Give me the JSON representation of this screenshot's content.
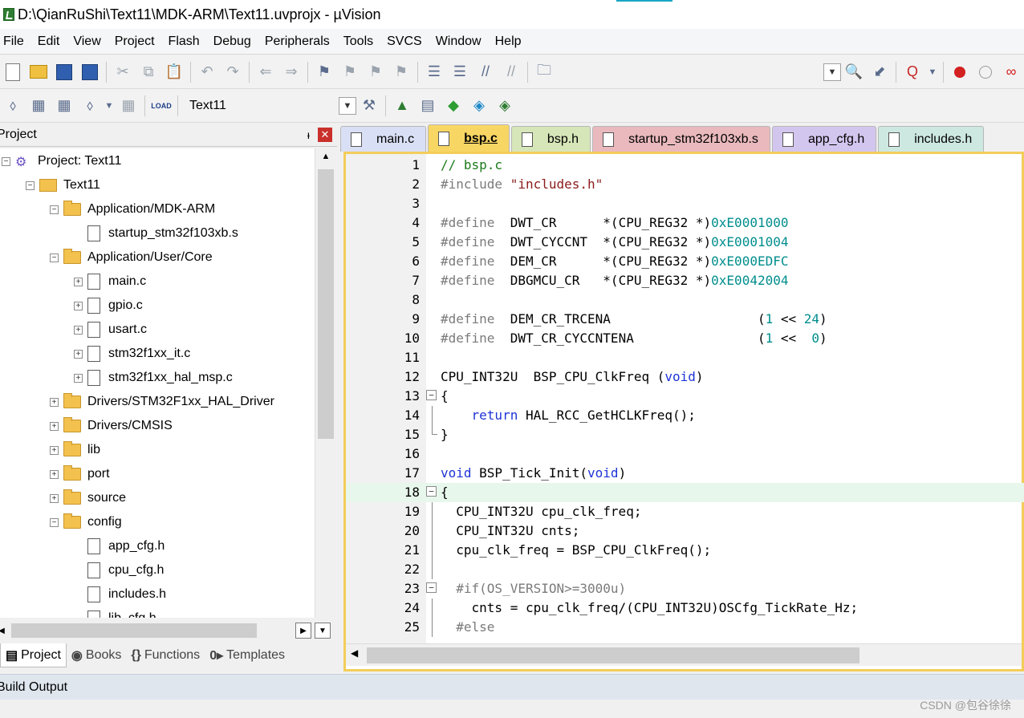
{
  "window": {
    "title": "D:\\QianRuShi\\Text11\\MDK-ARM\\Text11.uvprojx - µVision"
  },
  "menu": [
    "File",
    "Edit",
    "View",
    "Project",
    "Flash",
    "Debug",
    "Peripherals",
    "Tools",
    "SVCS",
    "Window",
    "Help"
  ],
  "toolbar": {
    "target_name": "Text11",
    "load_label": "LOAD"
  },
  "project_panel": {
    "title": "Project",
    "tree": [
      {
        "label": "Project: Text11",
        "expander": "−"
      },
      {
        "label": "Text11",
        "expander": "−"
      },
      {
        "label": "Application/MDK-ARM",
        "expander": "−"
      },
      {
        "label": "startup_stm32f103xb.s",
        "expander": ""
      },
      {
        "label": "Application/User/Core",
        "expander": "−"
      },
      {
        "label": "main.c",
        "expander": "+"
      },
      {
        "label": "gpio.c",
        "expander": "+"
      },
      {
        "label": "usart.c",
        "expander": "+"
      },
      {
        "label": "stm32f1xx_it.c",
        "expander": "+"
      },
      {
        "label": "stm32f1xx_hal_msp.c",
        "expander": "+"
      },
      {
        "label": "Drivers/STM32F1xx_HAL_Driver",
        "expander": "+"
      },
      {
        "label": "Drivers/CMSIS",
        "expander": "+"
      },
      {
        "label": "lib",
        "expander": "+"
      },
      {
        "label": "port",
        "expander": "+"
      },
      {
        "label": "source",
        "expander": "+"
      },
      {
        "label": "config",
        "expander": "−"
      },
      {
        "label": "app_cfg.h",
        "expander": ""
      },
      {
        "label": "cpu_cfg.h",
        "expander": ""
      },
      {
        "label": "includes.h",
        "expander": ""
      },
      {
        "label": "lib_cfg.h",
        "expander": ""
      }
    ],
    "bottom_tabs": [
      {
        "icon": "▤",
        "label": "Project"
      },
      {
        "icon": "◉",
        "label": "Books"
      },
      {
        "icon": "{}",
        "label": "Functions"
      },
      {
        "icon": "0▸",
        "label": "Templates"
      }
    ]
  },
  "editor": {
    "tabs": [
      {
        "label": "main.c",
        "color": "#d9dff4"
      },
      {
        "label": "bsp.c",
        "color": "#f8d664"
      },
      {
        "label": "bsp.h",
        "color": "#d6e6b8"
      },
      {
        "label": "startup_stm32f103xb.s",
        "color": "#e9b9bd"
      },
      {
        "label": "app_cfg.h",
        "color": "#d3c6ee"
      },
      {
        "label": "includes.h",
        "color": "#cde8e0"
      }
    ],
    "lines": [
      {
        "n": "1",
        "t": [
          [
            "c",
            "// bsp.c"
          ]
        ]
      },
      {
        "n": "2",
        "t": [
          [
            "p",
            "#include "
          ],
          [
            "s",
            "\"includes.h\""
          ]
        ]
      },
      {
        "n": "3",
        "t": []
      },
      {
        "n": "4",
        "t": [
          [
            "p",
            "#define  "
          ],
          [
            "x",
            "DWT_CR      *(CPU_REG32 *)"
          ],
          [
            "d",
            "0xE0001000"
          ]
        ]
      },
      {
        "n": "5",
        "t": [
          [
            "p",
            "#define  "
          ],
          [
            "x",
            "DWT_CYCCNT  *(CPU_REG32 *)"
          ],
          [
            "d",
            "0xE0001004"
          ]
        ]
      },
      {
        "n": "6",
        "t": [
          [
            "p",
            "#define  "
          ],
          [
            "x",
            "DEM_CR      *(CPU_REG32 *)"
          ],
          [
            "d",
            "0xE000EDFC"
          ]
        ]
      },
      {
        "n": "7",
        "t": [
          [
            "p",
            "#define  "
          ],
          [
            "x",
            "DBGMCU_CR   *(CPU_REG32 *)"
          ],
          [
            "d",
            "0xE0042004"
          ]
        ]
      },
      {
        "n": "8",
        "t": []
      },
      {
        "n": "9",
        "t": [
          [
            "p",
            "#define  "
          ],
          [
            "x",
            "DEM_CR_TRCENA                   ("
          ],
          [
            "d",
            "1"
          ],
          [
            "x",
            " << "
          ],
          [
            "d",
            "24"
          ],
          [
            "x",
            ")"
          ]
        ]
      },
      {
        "n": "10",
        "t": [
          [
            "p",
            "#define  "
          ],
          [
            "x",
            "DWT_CR_CYCCNTENA                ("
          ],
          [
            "d",
            "1"
          ],
          [
            "x",
            " <<  "
          ],
          [
            "d",
            "0"
          ],
          [
            "x",
            ")"
          ]
        ]
      },
      {
        "n": "11",
        "t": []
      },
      {
        "n": "12",
        "t": [
          [
            "x",
            "CPU_INT32U  BSP_CPU_ClkFreq ("
          ],
          [
            "k",
            "void"
          ],
          [
            "x",
            ")"
          ]
        ]
      },
      {
        "n": "13",
        "t": [
          [
            "x",
            "{"
          ]
        ],
        "fold": "−"
      },
      {
        "n": "14",
        "t": [
          [
            "x",
            "    "
          ],
          [
            "k",
            "return"
          ],
          [
            "x",
            " HAL_RCC_GetHCLKFreq();"
          ]
        ],
        "bar": true
      },
      {
        "n": "15",
        "t": [
          [
            "x",
            "}"
          ]
        ],
        "end": true
      },
      {
        "n": "16",
        "t": []
      },
      {
        "n": "17",
        "t": [
          [
            "k",
            "void"
          ],
          [
            "x",
            " BSP_Tick_Init("
          ],
          [
            "k",
            "void"
          ],
          [
            "x",
            ")"
          ]
        ]
      },
      {
        "n": "18",
        "t": [
          [
            "x",
            "{"
          ]
        ],
        "fold": "−",
        "hl": true
      },
      {
        "n": "19",
        "t": [
          [
            "x",
            "  CPU_INT32U cpu_clk_freq;"
          ]
        ],
        "bar": true
      },
      {
        "n": "20",
        "t": [
          [
            "x",
            "  CPU_INT32U cnts;"
          ]
        ],
        "bar": true
      },
      {
        "n": "21",
        "t": [
          [
            "x",
            "  cpu_clk_freq = BSP_CPU_ClkFreq();"
          ]
        ],
        "bar": true
      },
      {
        "n": "22",
        "t": [],
        "bar": true
      },
      {
        "n": "23",
        "t": [
          [
            "x",
            "  "
          ],
          [
            "p",
            "#if(OS_VERSION>=3000u)"
          ]
        ],
        "fold": "−"
      },
      {
        "n": "24",
        "t": [
          [
            "x",
            "    cnts = cpu_clk_freq/(CPU_INT32U)OSCfg_TickRate_Hz;"
          ]
        ],
        "bar": true
      },
      {
        "n": "25",
        "t": [
          [
            "x",
            "  "
          ],
          [
            "p",
            "#else"
          ]
        ],
        "bar": true
      }
    ]
  },
  "build_output": {
    "title": "Build Output"
  },
  "watermark": "CSDN @包谷徐徐",
  "colors": {
    "editor_active_frame": "#f3cd5a",
    "line_highlight": "#e8f7ec",
    "keyword": "#1f33d6",
    "comment": "#1c7a1c",
    "number": "#008d8d",
    "string": "#8b1a1a",
    "preprocessor": "#7b7b7b"
  }
}
